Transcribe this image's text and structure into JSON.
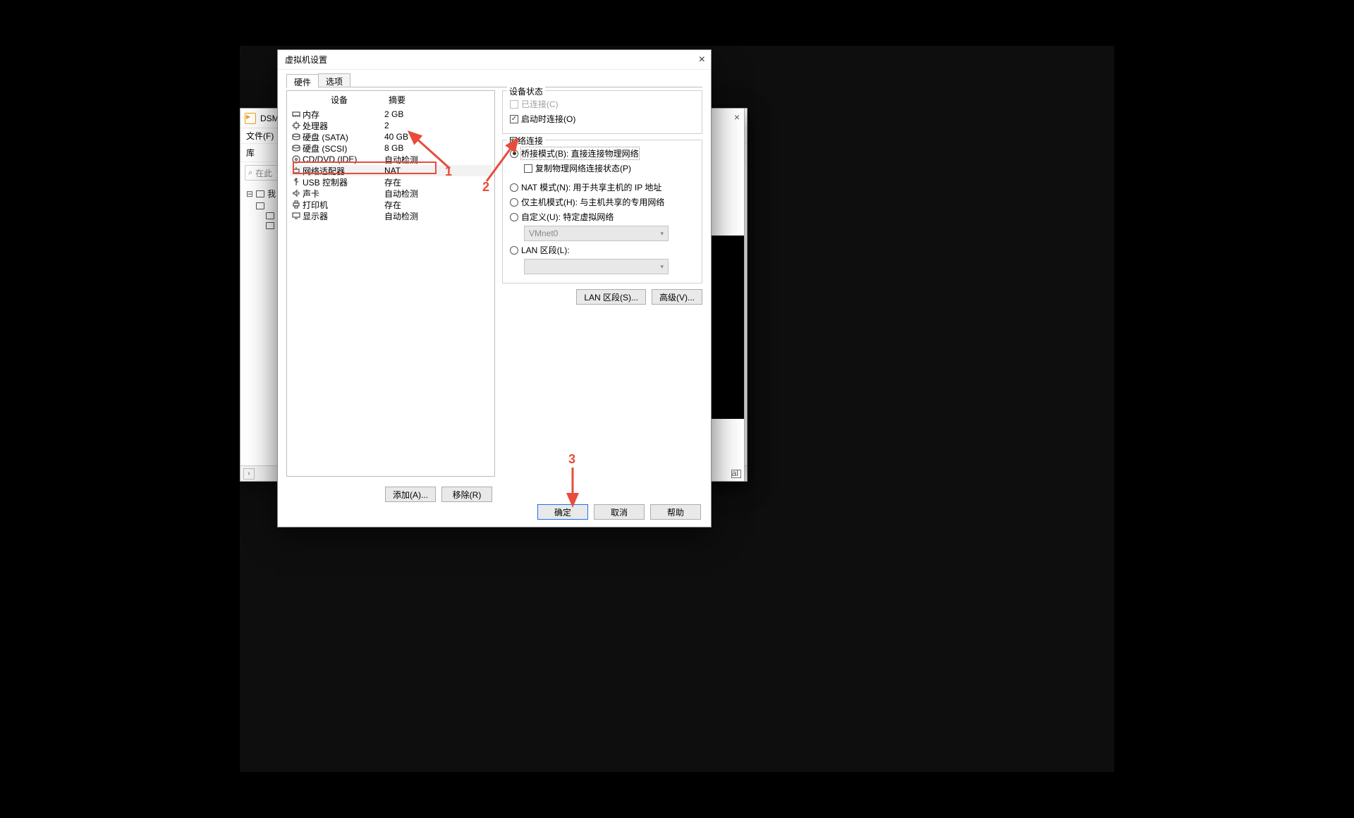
{
  "bg": {
    "title": "DSM",
    "menu_file": "文件(F)",
    "sidebar_label": "库",
    "search_placeholder": "在此",
    "tree_root_label": "我",
    "win_close": "×",
    "right_text": "al"
  },
  "dialog": {
    "title": "虚拟机设置",
    "close": "×",
    "tabs": {
      "hardware": "硬件",
      "options": "选项"
    },
    "columns": {
      "device": "设备",
      "summary": "摘要"
    },
    "devices": [
      {
        "name": "内存",
        "summary": "2 GB",
        "icon": "memory"
      },
      {
        "name": "处理器",
        "summary": "2",
        "icon": "cpu"
      },
      {
        "name": "硬盘 (SATA)",
        "summary": "40 GB",
        "icon": "disk"
      },
      {
        "name": "硬盘 (SCSI)",
        "summary": "8 GB",
        "icon": "disk"
      },
      {
        "name": "CD/DVD (IDE)",
        "summary": "自动检测",
        "icon": "cd"
      },
      {
        "name": "网络适配器",
        "summary": "NAT",
        "icon": "net",
        "selected": true
      },
      {
        "name": "USB 控制器",
        "summary": "存在",
        "icon": "usb"
      },
      {
        "name": "声卡",
        "summary": "自动检测",
        "icon": "sound"
      },
      {
        "name": "打印机",
        "summary": "存在",
        "icon": "printer"
      },
      {
        "name": "显示器",
        "summary": "自动检测",
        "icon": "display"
      }
    ],
    "addBtn": "添加(A)...",
    "removeBtn": "移除(R)",
    "deviceStatus": {
      "title": "设备状态",
      "connected": "已连接(C)",
      "connectAtPowerOn": "启动时连接(O)"
    },
    "netConn": {
      "title": "网络连接",
      "bridged": "桥接模式(B): 直接连接物理网络",
      "replicate": "复制物理网络连接状态(P)",
      "nat": "NAT 模式(N): 用于共享主机的 IP 地址",
      "hostOnly": "仅主机模式(H): 与主机共享的专用网络",
      "custom": "自定义(U): 特定虚拟网络",
      "customValue": "VMnet0",
      "lanSegment": "LAN 区段(L):"
    },
    "lanSegBtn": "LAN 区段(S)...",
    "advBtn": "高级(V)...",
    "okBtn": "确定",
    "cancelBtn": "取消",
    "helpBtn": "帮助"
  },
  "annotations": {
    "n1": "1",
    "n2": "2",
    "n3": "3"
  }
}
